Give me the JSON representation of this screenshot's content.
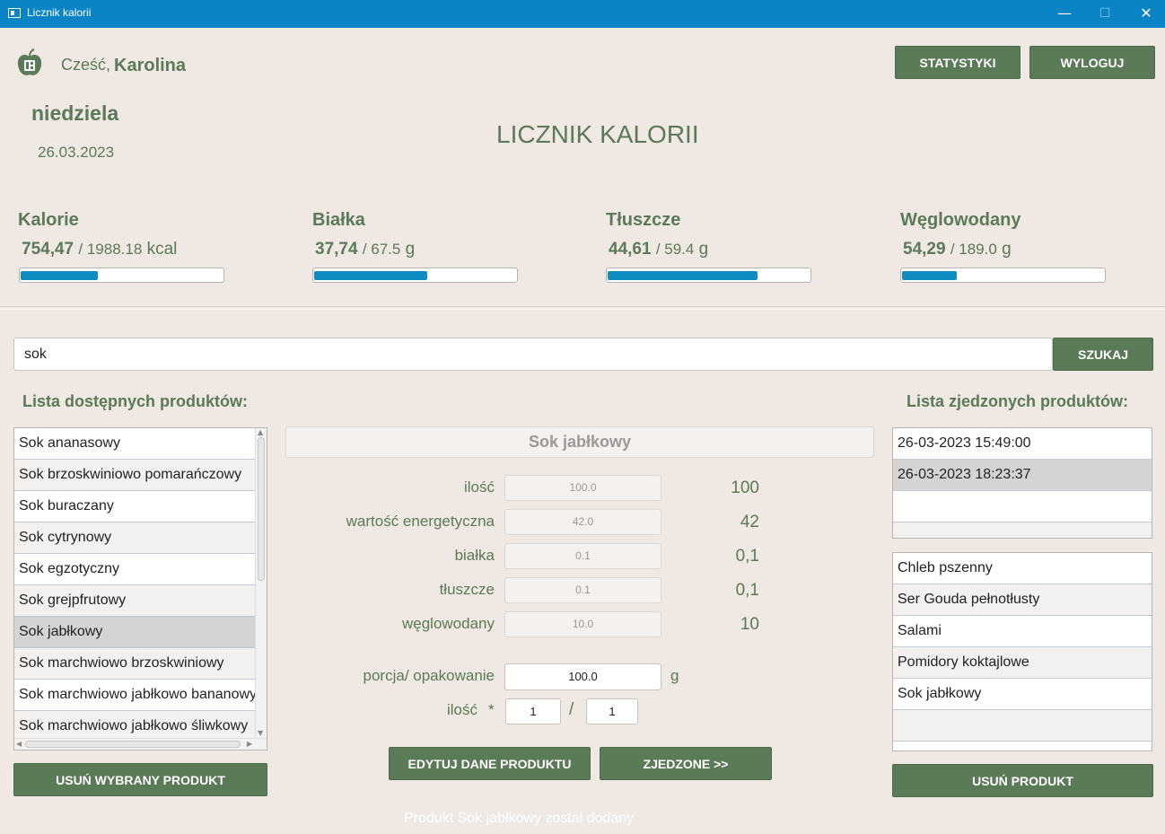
{
  "window": {
    "title": "Licznik kalorii",
    "minimize": "—",
    "maximize": "☐",
    "close": "✕"
  },
  "header": {
    "greeting": "Cześć,",
    "user_name": "Karolina",
    "day": "niedziela",
    "date": "26.03.2023",
    "app_heading": "LICZNIK KALORII",
    "stats_button": "STATYSTYKI",
    "logout_button": "WYLOGUJ"
  },
  "macros": [
    {
      "name": "Kalorie",
      "current": "754,47",
      "target": "/ 1988.18",
      "unit": "kcal",
      "progress": 0.38
    },
    {
      "name": "Białka",
      "current": "37,74",
      "target": "/ 67.5",
      "unit": "g",
      "progress": 0.56
    },
    {
      "name": "Tłuszcze",
      "current": "44,61",
      "target": "/ 59.4",
      "unit": "g",
      "progress": 0.74
    },
    {
      "name": "Węglowodany",
      "current": "54,29",
      "target": "/ 189.0",
      "unit": "g",
      "progress": 0.27
    }
  ],
  "search": {
    "value": "sok",
    "button": "SZUKAJ"
  },
  "available": {
    "header": "Lista dostępnych produktów:",
    "items": [
      "Sok ananasowy",
      "Sok brzoskwiniowo pomarańczowy",
      "Sok buraczany",
      "Sok cytrynowy",
      "Sok egzotyczny",
      "Sok grejpfrutowy",
      "Sok jabłkowy",
      "Sok marchwiowo brzoskwiniowy",
      "Sok marchwiowo jabłkowo bananowy",
      "Sok marchwiowo jabłkowo śliwkowy"
    ],
    "selected_index": 6,
    "remove_button": "USUŃ WYBRANY PRODUKT"
  },
  "product": {
    "name": "Sok jabłkowy",
    "fields": [
      {
        "label": "ilość",
        "box": "100.0",
        "value": "100"
      },
      {
        "label": "wartość energetyczna",
        "box": "42.0",
        "value": "42"
      },
      {
        "label": "białka",
        "box": "0.1",
        "value": "0,1"
      },
      {
        "label": "tłuszcze",
        "box": "0.1",
        "value": "0,1"
      },
      {
        "label": "węglowodany",
        "box": "10.0",
        "value": "10"
      }
    ],
    "portion_label": "porcja/ opakowanie",
    "portion_value": "100.0",
    "portion_unit": "g",
    "qty_label": "ilość",
    "qty_asterisk": "*",
    "qty_numerator": "1",
    "qty_slash": "/",
    "qty_denominator": "1",
    "edit_button": "EDYTUJ DANE PRODUKTU",
    "eaten_button": "ZJEDZONE  >>"
  },
  "eaten": {
    "header": "Lista zjedzonych produktów:",
    "meals": [
      "26-03-2023 15:49:00",
      "26-03-2023 18:23:37"
    ],
    "selected_meal_index": 1,
    "items": [
      "Chleb pszenny",
      "Ser Gouda pełnotłusty",
      "Salami",
      "Pomidory koktajlowe",
      "Sok jabłkowy"
    ],
    "remove_button": "USUŃ PRODUKT"
  },
  "status_message": "Produkt Sok jabłkowy został dodany",
  "colors": {
    "accent_green": "#5b7a57",
    "titlebar": "#0b84c6",
    "progress_fill": "#0f8cc0",
    "background": "#efe8e3"
  }
}
